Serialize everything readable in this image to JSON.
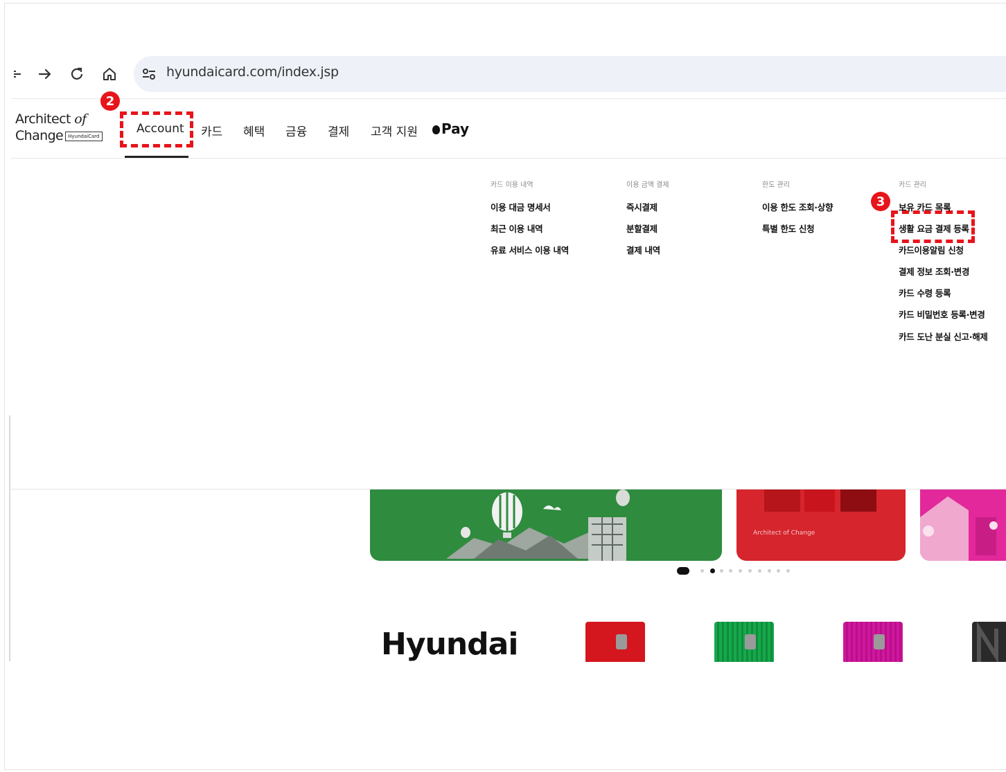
{
  "browser": {
    "url": "hyundaicard.com/index.jsp",
    "icons": [
      "back-partial-icon",
      "forward-arrow-icon",
      "reload-icon",
      "home-icon",
      "site-settings-icon"
    ]
  },
  "header": {
    "logo_line1": "Architect ",
    "logo_line1_italic": "of",
    "logo_line2": "Change",
    "logo_box": "HyundaiCard",
    "nav": {
      "account": "Account",
      "card": "카드",
      "benefits": "혜택",
      "finance": "금융",
      "payment": "결제",
      "support": "고객 지원",
      "applepay": "Pay"
    }
  },
  "annotations": {
    "step2": "2",
    "step3": "3",
    "color": "#e8141b"
  },
  "dropdown": {
    "columns": [
      {
        "heading": "카드 이용 내역",
        "items": [
          "이용 대금 명세서",
          "최근 이용 내역",
          "유료 서비스 이용 내역"
        ]
      },
      {
        "heading": "이용 금액 결제",
        "items": [
          "즉시결제",
          "분할결제",
          "결제 내역"
        ]
      },
      {
        "heading": "한도 관리",
        "items": [
          "이용 한도 조회·상향",
          "특별 한도 신청"
        ]
      },
      {
        "heading": "카드 관리",
        "items": [
          "보유 카드 목록",
          "생활 요금 결제 등록",
          "카드이용알림 신청",
          "결제 정보 조회·변경",
          "카드 수령 등록",
          "카드 비밀번호 등록·변경",
          "카드 도난 분실 신고·해제"
        ]
      }
    ]
  },
  "banners": {
    "red_logo": "Architect of Change",
    "colors": {
      "green": "#2f8b3e",
      "red": "#d6252c",
      "pink": "#e2289a"
    }
  },
  "carousel": {
    "pause_icon": "pause-icon",
    "dot_count": 10,
    "active_index": 1
  },
  "bottom": {
    "brand_text": "Hyundai",
    "card_colors": [
      "#d4161f",
      "#17a84b",
      "#d0179e",
      "#2a2a2a"
    ]
  }
}
